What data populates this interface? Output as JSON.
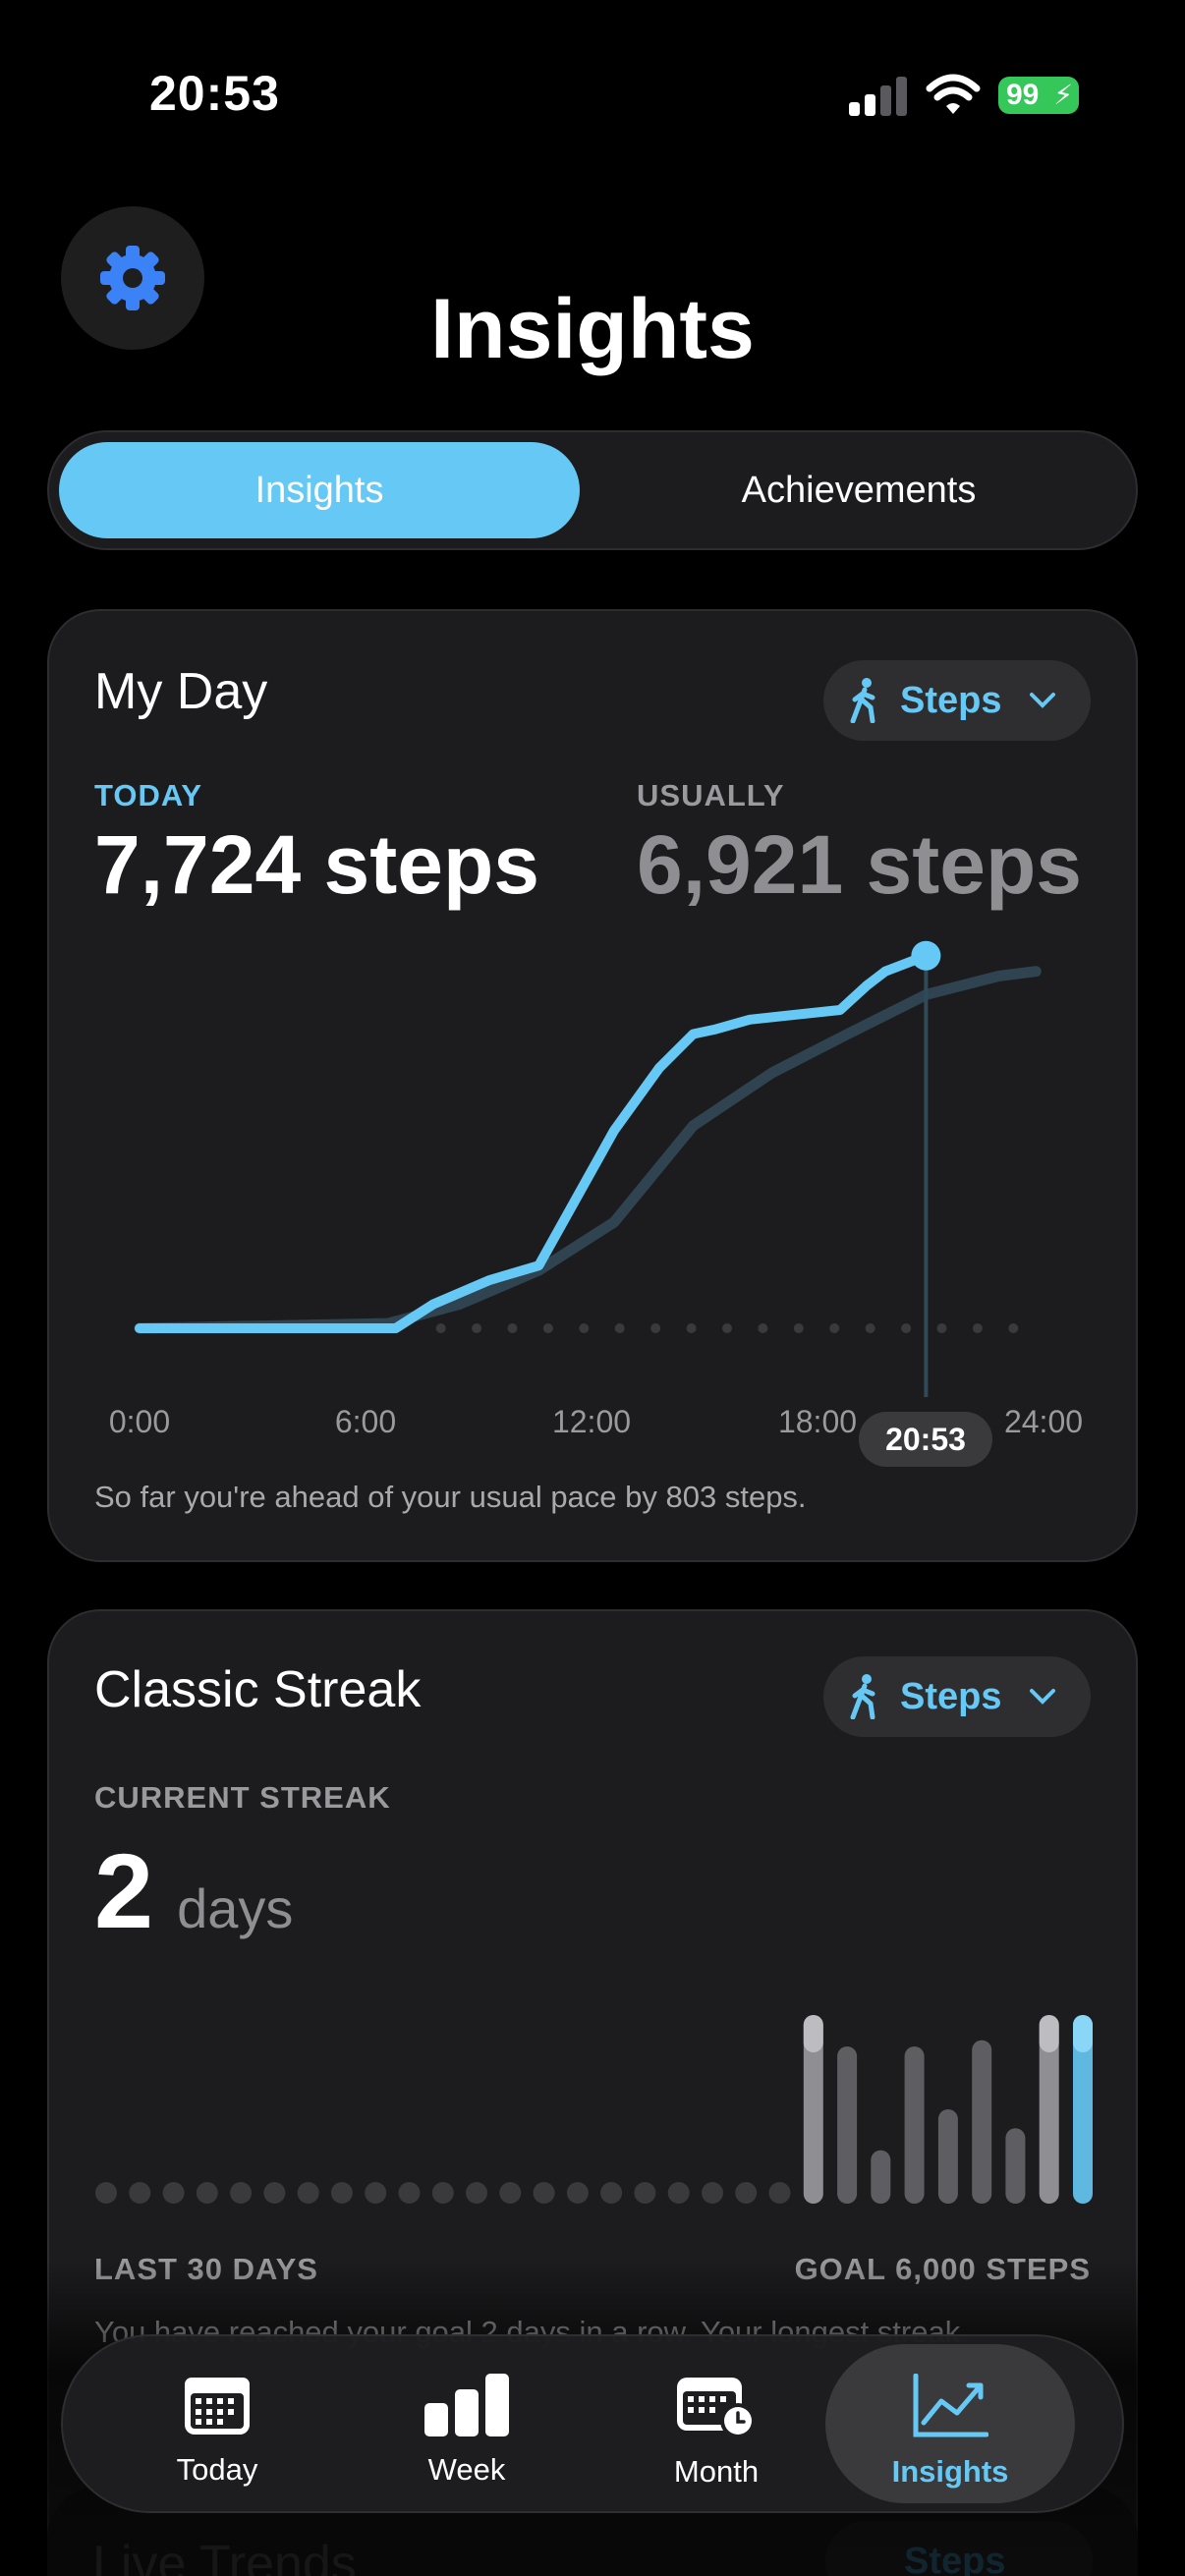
{
  "status_bar": {
    "time": "20:53",
    "battery": "99"
  },
  "header": {
    "title": "Insights",
    "settings_icon": "gear-icon"
  },
  "segmented": {
    "options": [
      "Insights",
      "Achievements"
    ],
    "selected": "Insights"
  },
  "colors": {
    "accent": "#66c9f5",
    "settings_gear": "#3b82f6",
    "battery": "#35c759",
    "card_bg": "#1c1c1e",
    "usual_line": "#2f4450"
  },
  "my_day": {
    "title": "My Day",
    "metric_selector": "Steps",
    "today_label": "TODAY",
    "today_value": "7,724 steps",
    "usually_label": "USUALLY",
    "usually_value": "6,921 steps",
    "now_label": "20:53",
    "footnote": "So far you're ahead of your usual pace by 803 steps."
  },
  "classic_streak": {
    "title": "Classic Streak",
    "metric_selector": "Steps",
    "current_label": "CURRENT STREAK",
    "current_value": "2",
    "current_unit": "days",
    "left_caption": "LAST 30 DAYS",
    "right_caption": "GOAL 6,000 STEPS",
    "footnote": "You have reached your goal 2 days in a row. Your longest streak"
  },
  "next_card": {
    "title": "Live Trends",
    "metric_selector": "Steps"
  },
  "tab_bar": {
    "items": [
      {
        "label": "Today",
        "icon": "calendar-grid-icon"
      },
      {
        "label": "Week",
        "icon": "bar-chart-icon"
      },
      {
        "label": "Month",
        "icon": "calendar-clock-icon"
      },
      {
        "label": "Insights",
        "icon": "trend-chart-icon"
      }
    ],
    "selected": "Insights"
  },
  "chart_data": [
    {
      "type": "line",
      "x_ticks": [
        "0:00",
        "6:00",
        "12:00",
        "18:00",
        "24:00"
      ],
      "xlim": [
        0,
        24
      ],
      "series": [
        {
          "name": "TODAY",
          "x": [
            0,
            6.8,
            7.8,
            9.3,
            10.6,
            12.6,
            13.8,
            14.7,
            15.3,
            16.2,
            17.4,
            18.6,
            19.3,
            19.8,
            20.88
          ],
          "y": [
            0,
            0,
            500,
            1000,
            1300,
            4100,
            5400,
            6100,
            6200,
            6400,
            6500,
            6600,
            7100,
            7400,
            7724
          ]
        },
        {
          "name": "USUALLY",
          "x": [
            0,
            6.6,
            8.5,
            10.6,
            12.6,
            14.7,
            16.8,
            18.8,
            20.9,
            22.8,
            23.8
          ],
          "y": [
            0,
            100,
            500,
            1200,
            2200,
            4200,
            5300,
            6100,
            6921,
            7300,
            7400
          ]
        }
      ]
    },
    {
      "type": "bar",
      "title": "LAST 30 DAYS",
      "goal": 6000,
      "values": [
        0,
        0,
        0,
        0,
        0,
        0,
        0,
        0,
        0,
        0,
        0,
        0,
        0,
        0,
        0,
        0,
        0,
        0,
        0,
        0,
        0,
        6000,
        5000,
        1700,
        5000,
        3000,
        5200,
        2400,
        6000,
        6000
      ],
      "met_goal": [
        false,
        false,
        false,
        false,
        false,
        false,
        false,
        false,
        false,
        false,
        false,
        false,
        false,
        false,
        false,
        false,
        false,
        false,
        false,
        false,
        false,
        true,
        false,
        false,
        false,
        false,
        false,
        false,
        true,
        true
      ]
    }
  ]
}
